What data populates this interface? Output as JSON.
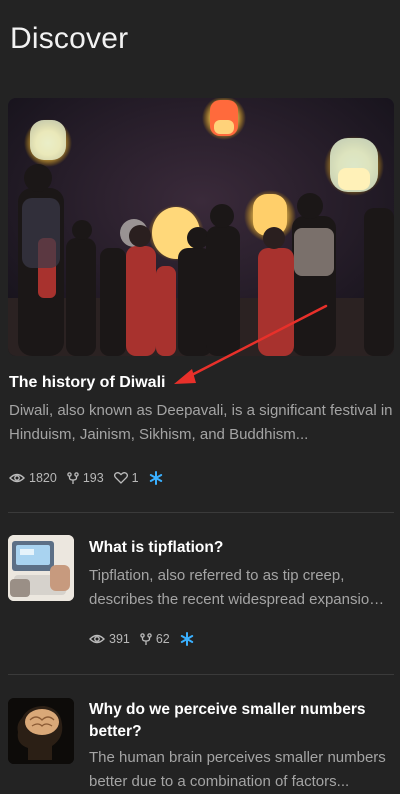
{
  "header": {
    "title": "Discover"
  },
  "featured": {
    "title": "The history of Diwali",
    "description": "Diwali, also known as Deepavali, is a significant festival in Hinduism, Jainism, Sikhism, and Buddhism...",
    "views": "1820",
    "forks": "193",
    "likes": "1"
  },
  "articles": [
    {
      "title": "What is tipflation?",
      "description": "Tipflation, also referred to as tip creep, describes the recent widespread expansion of tipping...",
      "views": "391",
      "forks": "62"
    },
    {
      "title": "Why do we perceive smaller numbers better?",
      "description": "The human brain perceives smaller numbers better due to a combination of factors..."
    }
  ],
  "colors": {
    "background": "#232323",
    "accent": "#3ab0ff",
    "annotation": "#e8302a"
  }
}
